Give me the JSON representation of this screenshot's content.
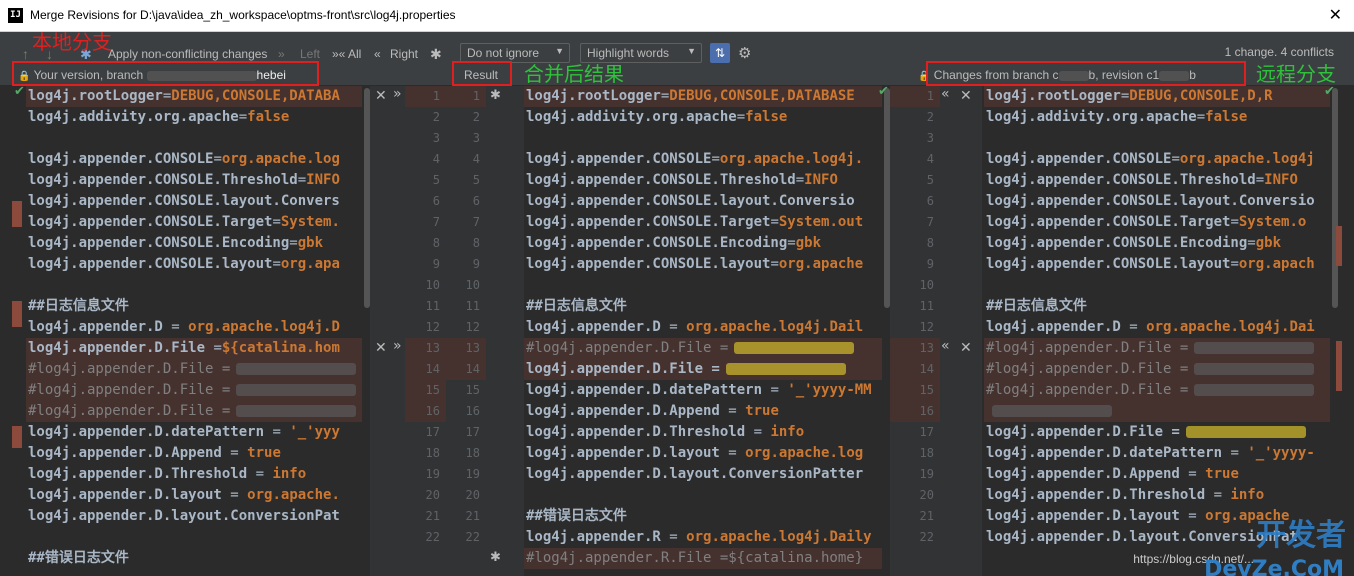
{
  "window": {
    "app_icon_glyph": "IJ",
    "title": "Merge Revisions for D:\\java\\idea_zh_workspace\\optms-front\\src\\log4j.properties",
    "close_glyph": "✕"
  },
  "toolbar": {
    "apply_label": "Apply non-conflicting changes",
    "left_label": "Left",
    "all_label": "All",
    "right_label": "Right",
    "whitespace_select": "Do not ignore",
    "highlight_select": "Highlight words",
    "status": "1 change. 4 conflicts",
    "left_header": "Your version, branch ",
    "left_header_suffix": "hebei",
    "result_header": "Result",
    "right_header_prefix": "Changes from branch c",
    "right_header_mid": "b, revision c1",
    "right_header_suffix": "b"
  },
  "annotations": {
    "local_branch": "本地分支",
    "merged_result": "合并后结果",
    "remote_branch": "远程分支"
  },
  "colors": {
    "annotation_red": "#e02020",
    "annotation_green": "#2ec23b",
    "conflict_bg": "#45322f",
    "keyword_orange": "#cc7832",
    "accent_blue": "#4b6eaf"
  },
  "left_gutter": [
    "1",
    "2",
    "3",
    "4",
    "5",
    "6",
    "7",
    "8",
    "9",
    "10",
    "11",
    "12",
    "13",
    "14",
    "15",
    "16",
    "17",
    "18",
    "19",
    "20",
    "21",
    "22"
  ],
  "result_gutter": [
    "1",
    "2",
    "3",
    "4",
    "5",
    "6",
    "7",
    "8",
    "9",
    "10",
    "11",
    "12",
    "13",
    "14",
    "15",
    "16",
    "17",
    "18",
    "19",
    "20",
    "21",
    "22"
  ],
  "right_gutter": [
    "1",
    "2",
    "3",
    "4",
    "5",
    "6",
    "7",
    "8",
    "9",
    "10",
    "11",
    "12",
    "13",
    "14",
    "15",
    "16",
    "17",
    "18",
    "19",
    "20",
    "21",
    "22"
  ],
  "left_code": [
    {
      "k": "log4j.rootLogger",
      "eq": "=",
      "v": "DEBUG,CONSOLE,DATABA",
      "cls": "conflict"
    },
    {
      "k": "log4j.addivity.org.apache",
      "eq": "=",
      "v": "false",
      "cls": ""
    },
    {
      "k": "",
      "eq": "",
      "v": "",
      "cls": ""
    },
    {
      "k": "log4j.appender.CONSOLE",
      "eq": "=",
      "v": "org.apache.log",
      "cls": ""
    },
    {
      "k": "log4j.appender.CONSOLE.Threshold",
      "eq": "=",
      "v": "INFO",
      "cls": ""
    },
    {
      "k": "log4j.appender.CONSOLE.layout.Convers",
      "eq": "",
      "v": "",
      "cls": ""
    },
    {
      "k": "log4j.appender.CONSOLE.Target",
      "eq": "=",
      "v": "System.",
      "cls": ""
    },
    {
      "k": "log4j.appender.CONSOLE.Encoding",
      "eq": "=",
      "v": "gbk",
      "cls": ""
    },
    {
      "k": "log4j.appender.CONSOLE.layout",
      "eq": "=",
      "v": "org.apa",
      "cls": ""
    },
    {
      "k": "",
      "eq": "",
      "v": "",
      "cls": ""
    },
    {
      "k": "##日志信息文件",
      "eq": "",
      "v": "",
      "cls": "comment"
    },
    {
      "k": "log4j.appender.D",
      "eq": " = ",
      "v": "org.apache.log4j.D",
      "cls": ""
    },
    {
      "k": "log4j.appender.D.File",
      "eq": " =",
      "v": "${catalina.hom",
      "cls": "conflict"
    },
    {
      "k": "#log4j.appender.D.File =",
      "eq": "",
      "v": "",
      "cls": "conflict-blur"
    },
    {
      "k": "#log4j.appender.D.File =",
      "eq": "",
      "v": "",
      "cls": "conflict-blur"
    },
    {
      "k": "#log4j.appender.D.File =",
      "eq": "",
      "v": "",
      "cls": "conflict-blur"
    },
    {
      "k": "log4j.appender.D.datePattern",
      "eq": " = ",
      "v": "'_'yyy",
      "cls": ""
    },
    {
      "k": "log4j.appender.D.Append",
      "eq": " = ",
      "v": "true",
      "cls": ""
    },
    {
      "k": "log4j.appender.D.Threshold",
      "eq": " = ",
      "v": "info",
      "cls": ""
    },
    {
      "k": "log4j.appender.D.layout",
      "eq": " = ",
      "v": "org.apache.",
      "cls": ""
    },
    {
      "k": "log4j.appender.D.layout.ConversionPat",
      "eq": "",
      "v": "",
      "cls": ""
    },
    {
      "k": "",
      "eq": "",
      "v": "",
      "cls": ""
    },
    {
      "k": "##错误日志文件",
      "eq": "",
      "v": "",
      "cls": "comment"
    }
  ],
  "result_code": [
    {
      "k": "log4j.rootLogger",
      "eq": "=",
      "v": "DEBUG,CONSOLE,DATABASE",
      "cls": "conflict"
    },
    {
      "k": "log4j.addivity.org.apache",
      "eq": "=",
      "v": "false",
      "cls": ""
    },
    {
      "k": "",
      "eq": "",
      "v": "",
      "cls": ""
    },
    {
      "k": "log4j.appender.CONSOLE",
      "eq": "=",
      "v": "org.apache.log4j.",
      "cls": ""
    },
    {
      "k": "log4j.appender.CONSOLE.Threshold",
      "eq": "=",
      "v": "INFO",
      "cls": ""
    },
    {
      "k": "log4j.appender.CONSOLE.layout.Conversio",
      "eq": "",
      "v": "",
      "cls": ""
    },
    {
      "k": "log4j.appender.CONSOLE.Target",
      "eq": "=",
      "v": "System.out",
      "cls": ""
    },
    {
      "k": "log4j.appender.CONSOLE.Encoding",
      "eq": "=",
      "v": "gbk",
      "cls": ""
    },
    {
      "k": "log4j.appender.CONSOLE.layout",
      "eq": "=",
      "v": "org.apache",
      "cls": ""
    },
    {
      "k": "",
      "eq": "",
      "v": "",
      "cls": ""
    },
    {
      "k": "##日志信息文件",
      "eq": "",
      "v": "",
      "cls": "comment"
    },
    {
      "k": "log4j.appender.D",
      "eq": " = ",
      "v": "org.apache.log4j.Dail",
      "cls": ""
    },
    {
      "k": "#log4j.appender.D.File =",
      "eq": "",
      "v": "",
      "cls": "conflict-blury"
    },
    {
      "k": "log4j.appender.D.File =",
      "eq": "",
      "v": "",
      "cls": "conflict-blury2"
    },
    {
      "k": "log4j.appender.D.datePattern",
      "eq": " = ",
      "v": "'_'yyyy-MM",
      "cls": ""
    },
    {
      "k": "log4j.appender.D.Append",
      "eq": " = ",
      "v": "true",
      "cls": ""
    },
    {
      "k": "log4j.appender.D.Threshold",
      "eq": " = ",
      "v": "info",
      "cls": ""
    },
    {
      "k": "log4j.appender.D.layout",
      "eq": " = ",
      "v": "org.apache.log",
      "cls": ""
    },
    {
      "k": "log4j.appender.D.layout.ConversionPatter",
      "eq": "",
      "v": "",
      "cls": ""
    },
    {
      "k": "",
      "eq": "",
      "v": "",
      "cls": ""
    },
    {
      "k": "##错误日志文件",
      "eq": "",
      "v": "",
      "cls": "comment"
    },
    {
      "k": "log4j.appender.R",
      "eq": " = ",
      "v": "org.apache.log4j.Daily",
      "cls": ""
    },
    {
      "k": "#log4j.appender.R.File =${catalina.home}",
      "eq": "",
      "v": "",
      "cls": "conflict-comment"
    }
  ],
  "right_code": [
    {
      "k": "log4j.rootLogger",
      "eq": "=",
      "v": "DEBUG,CONSOLE,D,R",
      "cls": "conflict"
    },
    {
      "k": "log4j.addivity.org.apache",
      "eq": "=",
      "v": "false",
      "cls": ""
    },
    {
      "k": "",
      "eq": "",
      "v": "",
      "cls": ""
    },
    {
      "k": "log4j.appender.CONSOLE",
      "eq": "=",
      "v": "org.apache.log4j",
      "cls": ""
    },
    {
      "k": "log4j.appender.CONSOLE.Threshold",
      "eq": "=",
      "v": "INFO",
      "cls": ""
    },
    {
      "k": "log4j.appender.CONSOLE.layout.Conversio",
      "eq": "",
      "v": "",
      "cls": ""
    },
    {
      "k": "log4j.appender.CONSOLE.Target",
      "eq": "=",
      "v": "System.o",
      "cls": ""
    },
    {
      "k": "log4j.appender.CONSOLE.Encoding",
      "eq": "=",
      "v": "gbk",
      "cls": ""
    },
    {
      "k": "log4j.appender.CONSOLE.layout",
      "eq": "=",
      "v": "org.apach",
      "cls": ""
    },
    {
      "k": "",
      "eq": "",
      "v": "",
      "cls": ""
    },
    {
      "k": "##日志信息文件",
      "eq": "",
      "v": "",
      "cls": "comment"
    },
    {
      "k": "log4j.appender.D",
      "eq": " = ",
      "v": "org.apache.log4j.Dai",
      "cls": ""
    },
    {
      "k": "#log4j.appender.D.File =",
      "eq": "",
      "v": "",
      "cls": "conflict-blur"
    },
    {
      "k": "#log4j.appender.D.File =",
      "eq": "",
      "v": "",
      "cls": "conflict-blur"
    },
    {
      "k": "#log4j.appender.D.File =",
      "eq": "",
      "v": "",
      "cls": "conflict-blur"
    },
    {
      "k": "",
      "eq": "",
      "v": "",
      "cls": "conflict-blur"
    },
    {
      "k": "log4j.appender.D.File =",
      "eq": "",
      "v": "",
      "cls": "blury"
    },
    {
      "k": "log4j.appender.D.datePattern",
      "eq": " = ",
      "v": "'_'yyyy-",
      "cls": ""
    },
    {
      "k": "log4j.appender.D.Append",
      "eq": " = ",
      "v": "true",
      "cls": ""
    },
    {
      "k": "log4j.appender.D.Threshold",
      "eq": " = ",
      "v": "info",
      "cls": ""
    },
    {
      "k": "log4j.appender.D.layout",
      "eq": " = ",
      "v": "org.apache",
      "cls": ""
    },
    {
      "k": "log4j.appender.D.layout.ConversionPat",
      "eq": "",
      "v": "",
      "cls": ""
    }
  ],
  "actions": {
    "reject": "✕",
    "accept_right": "»",
    "accept_left": "«",
    "check": "✔",
    "magic": "✱"
  },
  "watermark": {
    "url": "https://blog.csdn.net/...",
    "brand_cn": "开发者",
    "brand_en": "DevZe.CoM"
  }
}
